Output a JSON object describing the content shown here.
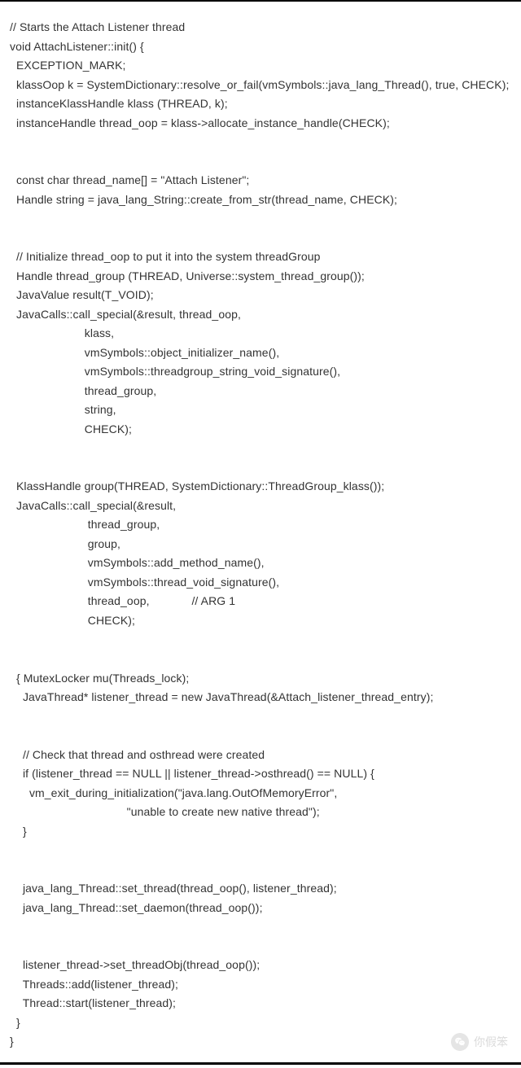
{
  "code": {
    "lines": [
      "// Starts the Attach Listener thread",
      "void AttachListener::init() {",
      "  EXCEPTION_MARK;",
      "  klassOop k = SystemDictionary::resolve_or_fail(vmSymbols::java_lang_Thread(), true, CHECK);",
      "  instanceKlassHandle klass (THREAD, k);",
      "  instanceHandle thread_oop = klass->allocate_instance_handle(CHECK);",
      "",
      "",
      "  const char thread_name[] = \"Attach Listener\";",
      "  Handle string = java_lang_String::create_from_str(thread_name, CHECK);",
      "",
      "",
      "  // Initialize thread_oop to put it into the system threadGroup",
      "  Handle thread_group (THREAD, Universe::system_thread_group());",
      "  JavaValue result(T_VOID);",
      "  JavaCalls::call_special(&result, thread_oop,",
      "                       klass,",
      "                       vmSymbols::object_initializer_name(),",
      "                       vmSymbols::threadgroup_string_void_signature(),",
      "                       thread_group,",
      "                       string,",
      "                       CHECK);",
      "",
      "",
      "  KlassHandle group(THREAD, SystemDictionary::ThreadGroup_klass());",
      "  JavaCalls::call_special(&result,",
      "                        thread_group,",
      "                        group,",
      "                        vmSymbols::add_method_name(),",
      "                        vmSymbols::thread_void_signature(),",
      "                        thread_oop,             // ARG 1",
      "                        CHECK);",
      "",
      "",
      "  { MutexLocker mu(Threads_lock);",
      "    JavaThread* listener_thread = new JavaThread(&Attach_listener_thread_entry);",
      "",
      "",
      "    // Check that thread and osthread were created",
      "    if (listener_thread == NULL || listener_thread->osthread() == NULL) {",
      "      vm_exit_during_initialization(\"java.lang.OutOfMemoryError\",",
      "                                    \"unable to create new native thread\");",
      "    }",
      "",
      "",
      "    java_lang_Thread::set_thread(thread_oop(), listener_thread);",
      "    java_lang_Thread::set_daemon(thread_oop());",
      "",
      "",
      "    listener_thread->set_threadObj(thread_oop());",
      "    Threads::add(listener_thread);",
      "    Thread::start(listener_thread);",
      "  }",
      "}"
    ]
  },
  "watermark": {
    "text": "你假笨"
  }
}
